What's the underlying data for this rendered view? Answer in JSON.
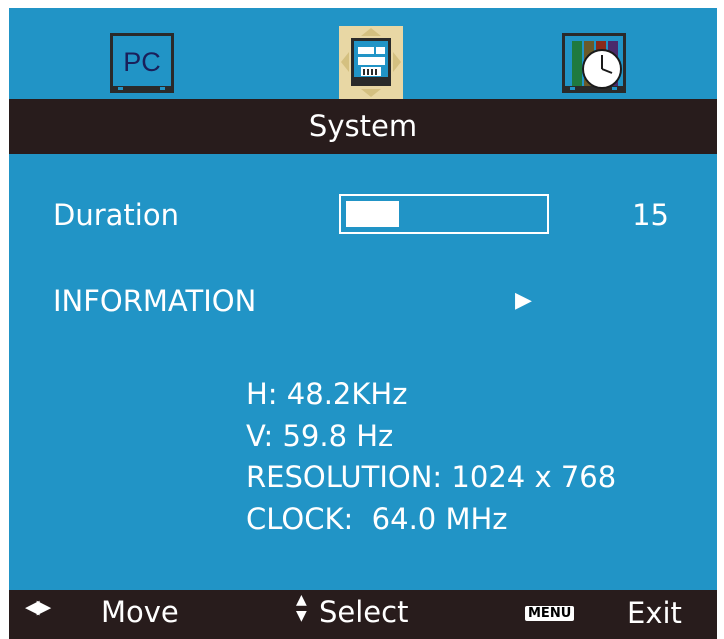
{
  "tabs": [
    {
      "name": "PC",
      "icon": "pc-monitor-icon",
      "selected": false
    },
    {
      "name": "System",
      "icon": "system-settings-icon",
      "selected": true
    },
    {
      "name": "Clock",
      "icon": "clock-icon",
      "selected": false
    }
  ],
  "header": {
    "title": "System"
  },
  "settings": {
    "duration": {
      "label": "Duration",
      "value": "15",
      "level": 0.27
    },
    "information": {
      "label": "INFORMATION",
      "arrow": "▶"
    }
  },
  "info": {
    "h_freq": "H: 48.2KHz",
    "v_freq": "V: 59.8 Hz",
    "resolution": "RESOLUTION: 1024 x 768",
    "clock": "CLOCK:  64.0 MHz"
  },
  "footer": {
    "move_icon": "◀▶",
    "move_label": "Move",
    "select_icon": "▲▼",
    "select_label": "Select",
    "menu_icon": "MENU",
    "exit_label": "Exit"
  },
  "colors": {
    "background": "#2194c6",
    "bar": "#281c1c",
    "text": "#ffffff",
    "selected_tab": "#e8d7a4"
  }
}
